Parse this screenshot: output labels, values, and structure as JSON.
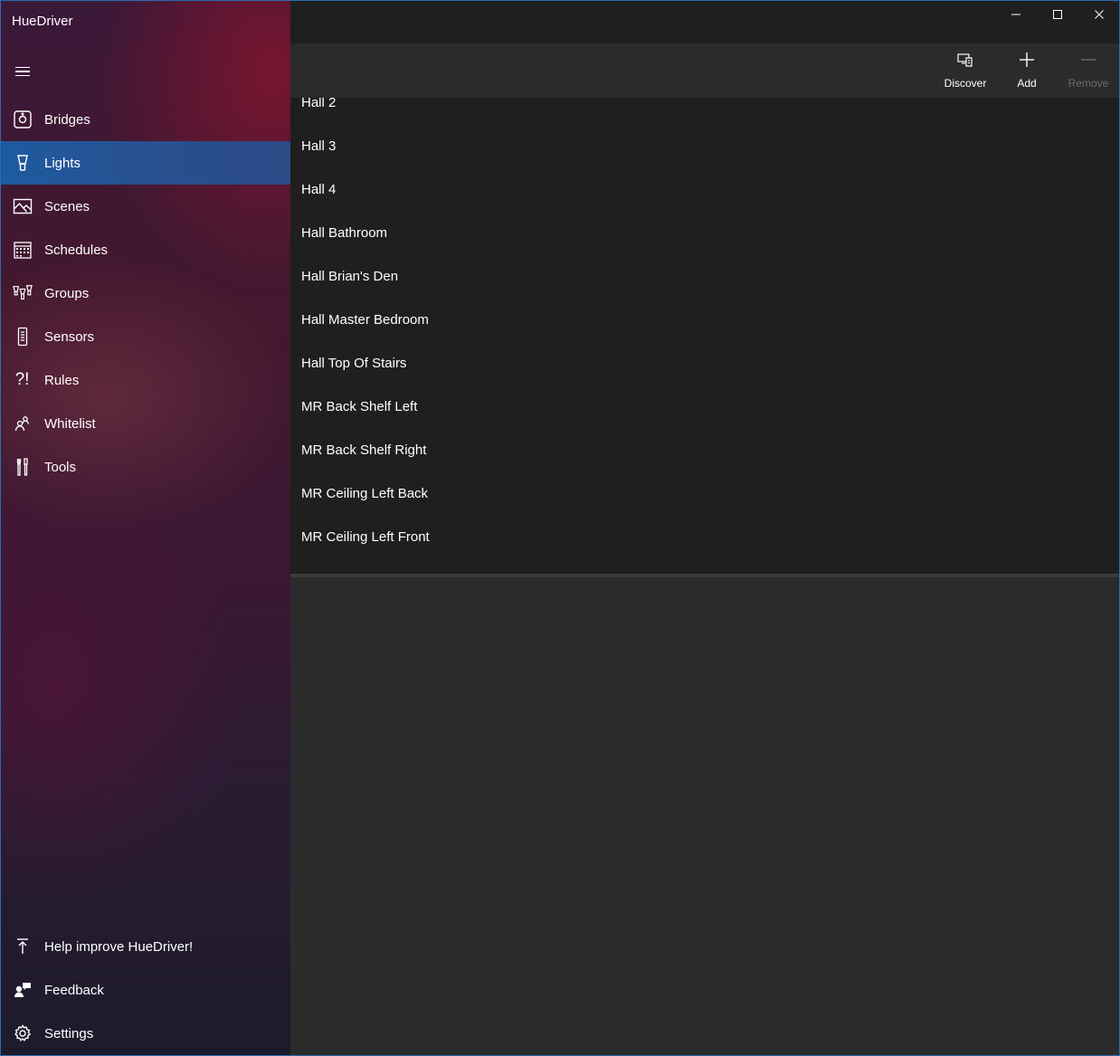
{
  "app": {
    "title": "HueDriver"
  },
  "nav": {
    "items": [
      {
        "label": "Bridges",
        "icon": "bridge-icon"
      },
      {
        "label": "Lights",
        "icon": "lightbulb-icon",
        "selected": true
      },
      {
        "label": "Scenes",
        "icon": "picture-icon"
      },
      {
        "label": "Schedules",
        "icon": "calendar-icon"
      },
      {
        "label": "Groups",
        "icon": "group-lights-icon"
      },
      {
        "label": "Sensors",
        "icon": "sensor-remote-icon"
      },
      {
        "label": "Rules",
        "icon": "rules-icon"
      },
      {
        "label": "Whitelist",
        "icon": "people-icon"
      },
      {
        "label": "Tools",
        "icon": "tools-icon"
      }
    ],
    "footer": [
      {
        "label": "Help improve HueDriver!",
        "icon": "upload-arrow-icon"
      },
      {
        "label": "Feedback",
        "icon": "feedback-icon"
      },
      {
        "label": "Settings",
        "icon": "gear-icon"
      }
    ]
  },
  "commands": {
    "discover": "Discover",
    "add": "Add",
    "remove": "Remove"
  },
  "lights": [
    "Hall 2",
    "Hall 3",
    "Hall 4",
    "Hall Bathroom",
    "Hall Brian's Den",
    "Hall Master Bedroom",
    "Hall Top Of Stairs",
    "MR Back Shelf Left",
    "MR Back Shelf Right",
    "MR Ceiling Left Back",
    "MR Ceiling Left Front"
  ],
  "colors": {
    "accent": "#1e5aa0",
    "list_bg": "#1f1f1f",
    "pane_bg": "#2b2b2b"
  }
}
